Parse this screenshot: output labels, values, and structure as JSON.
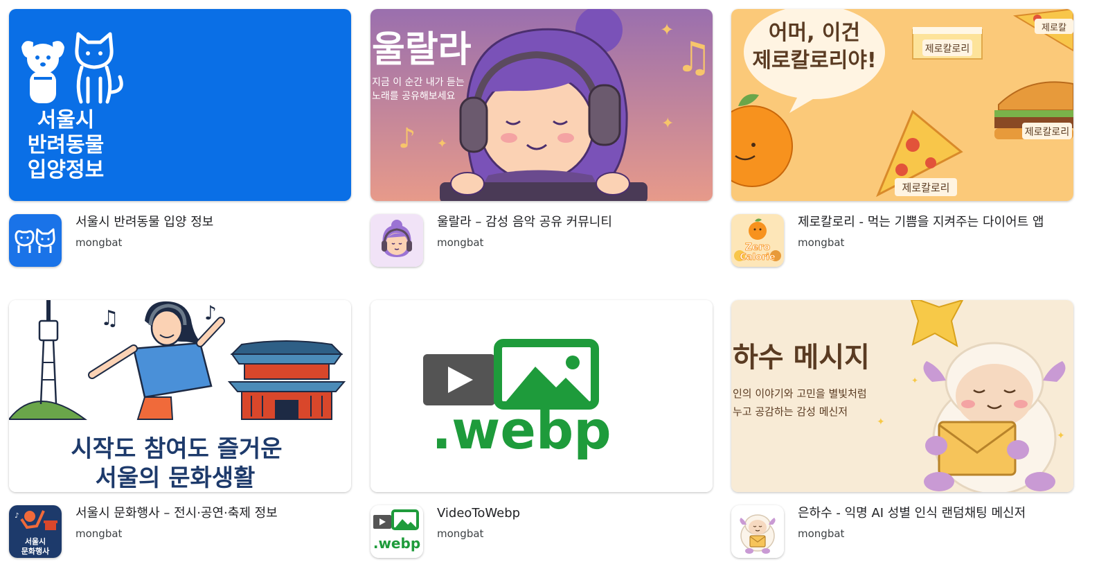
{
  "apps": [
    {
      "title": "서울시 반려동물 입양 정보",
      "developer": "mongbat",
      "banner_text": [
        "서울시",
        "반려동물",
        "입양정보"
      ],
      "accent": "#0a6fe6"
    },
    {
      "title": "울랄라 – 감성 음악 공유 커뮤니티",
      "developer": "mongbat",
      "banner_title": "울랄라",
      "banner_sub": [
        "지금 이 순간 내가 듣는",
        "노래를 공유해보세요"
      ],
      "accent": "#b07fb3"
    },
    {
      "title": "제로칼로리 - 먹는 기쁨을 지켜주는 다이어트 앱",
      "developer": "mongbat",
      "banner_bubble": [
        "어머, 이건",
        "제로칼로리야!"
      ],
      "banner_tags": [
        "제로칼로리",
        "제로칼",
        "제로칼로리",
        "제로칼로리"
      ],
      "icon_text": [
        "Zero",
        "Calorie"
      ],
      "accent": "#fbc16a"
    },
    {
      "title": "서울시 문화행사 – 전시·공연·축제 정보",
      "developer": "mongbat",
      "banner_text": [
        "시작도 참여도 즐거운",
        "서울의 문화생활"
      ],
      "icon_text": [
        "서울시",
        "문화행사"
      ],
      "accent": "#1d3a6b"
    },
    {
      "title": "VideoToWebp",
      "developer": "mongbat",
      "banner_text": ".webp",
      "icon_text": ".webp",
      "accent": "#1e9b3b"
    },
    {
      "title": "은하수 - 익명 AI 성별 인식 랜덤채팅 메신저",
      "developer": "mongbat",
      "banner_title": "하수 메시지",
      "banner_sub": [
        "인의 이야기와 고민을 별빛처럼",
        "누고 공감하는 감성 메신저"
      ],
      "accent": "#f6e7cf"
    }
  ]
}
